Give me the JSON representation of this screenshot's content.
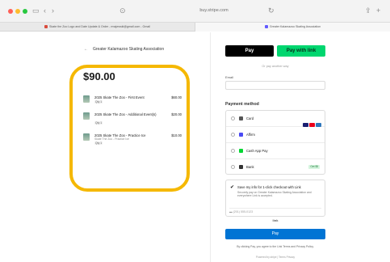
{
  "browser": {
    "address": "buy.stripe.com",
    "tabs": [
      {
        "label": "Skate the Zoo Logo and Date Update & Order - rmajewski@gmail.com - Gmail"
      },
      {
        "label": "Greater Kalamazoo Skating Association"
      }
    ]
  },
  "summary": {
    "merchant": "Greater Kalamazoo Skating Association",
    "total": "$90.00",
    "items": [
      {
        "name": "2025 Skate The Zoo - First Event",
        "sub": "",
        "qty": "Qty 1",
        "price": "$60.00"
      },
      {
        "name": "2025 Skate The Zoo - Additional Event(s)",
        "sub": "",
        "qty": "Qty 1",
        "price": "$20.00"
      },
      {
        "name": "2025 Skate The Zoo - Practice Ice",
        "sub": "Skate The Zoo - Practice Ice",
        "qty": "Qty 1",
        "price": "$10.00"
      }
    ],
    "highlight_color": "#f5b800"
  },
  "checkout": {
    "apple_pay": "Pay",
    "link_pay": "Pay with link",
    "or_text": "Or pay another way",
    "email_label": "Email",
    "payment_method_title": "Payment method",
    "methods": [
      {
        "label": "Card",
        "icon": "card-icon"
      },
      {
        "label": "Affirm",
        "icon": "affirm-icon"
      },
      {
        "label": "Cash App Pay",
        "icon": "cashapp-icon"
      },
      {
        "label": "Bank",
        "icon": "bank-icon",
        "badge": "Get $5"
      }
    ],
    "save_title": "Save my info for 1-click checkout with Link",
    "save_desc": "Securely pay on Greater Kalamazoo Skating Association and everywhere Link is accepted.",
    "phone_placeholder": "(201) 555-0123",
    "link_mark": "link",
    "pay_button": "Pay",
    "terms": "By clicking Pay, you agree to the Link Terms and Privacy Policy.",
    "footer": "Powered by stripe  |  Terms  Privacy",
    "accent": "#0074d4"
  }
}
